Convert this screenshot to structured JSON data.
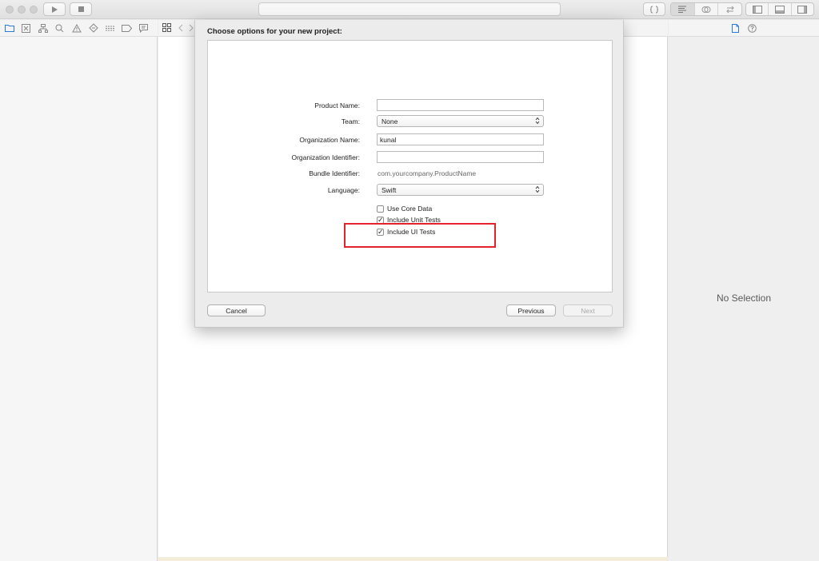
{
  "sheet": {
    "title": "Choose options for your new project:",
    "fields": {
      "product_name": {
        "label": "Product Name:",
        "value": ""
      },
      "team": {
        "label": "Team:",
        "value": "None"
      },
      "organization_name": {
        "label": "Organization Name:",
        "value": "kunal"
      },
      "organization_identifier": {
        "label": "Organization Identifier:",
        "value": ""
      },
      "bundle_identifier": {
        "label": "Bundle Identifier:",
        "value": "com.yourcompany.ProductName"
      },
      "language": {
        "label": "Language:",
        "value": "Swift"
      }
    },
    "checkboxes": {
      "use_core_data": {
        "label": "Use Core Data",
        "checked": false
      },
      "include_unit_tests": {
        "label": "Include Unit Tests",
        "checked": true
      },
      "include_ui_tests": {
        "label": "Include UI Tests",
        "checked": true
      }
    },
    "buttons": {
      "cancel": "Cancel",
      "previous": "Previous",
      "next": "Next"
    },
    "highlight_color": "#e4222b"
  },
  "inspector": {
    "empty_text": "No Selection"
  },
  "icons": {
    "toolbar": [
      "run-icon",
      "stop-icon",
      "code-snippet-icon",
      "editor-standard-icon",
      "editor-assistant-icon",
      "editor-version-icon",
      "navigator-toggle-icon",
      "debug-area-toggle-icon",
      "utilities-toggle-icon"
    ],
    "navigator": [
      "folder-icon",
      "source-control-icon",
      "symbol-icon",
      "find-icon",
      "issue-icon",
      "test-icon",
      "debug-icon",
      "breakpoint-icon",
      "report-icon"
    ],
    "inspector": [
      "file-inspector-icon",
      "quick-help-icon"
    ]
  }
}
